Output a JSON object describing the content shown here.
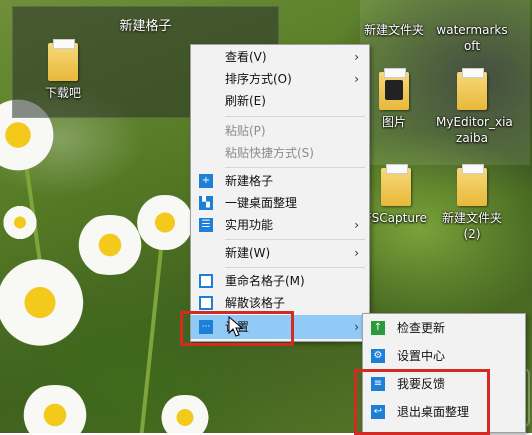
{
  "fence": {
    "title": "新建格子",
    "items": [
      {
        "name": "下载吧"
      }
    ]
  },
  "desktop_icons": [
    {
      "label": "新建文件夹"
    },
    {
      "label": "watermarks oft"
    },
    {
      "label": "图片"
    },
    {
      "label": "MyEditor_xia zaiba"
    },
    {
      "label": "FSCapture"
    },
    {
      "label": "新建文件夹 (2)"
    }
  ],
  "context_menu": {
    "items": [
      {
        "label": "查看(V)",
        "submenu": true
      },
      {
        "label": "排序方式(O)",
        "submenu": true
      },
      {
        "label": "刷新(E)"
      },
      {
        "label": "粘贴(P)",
        "disabled": true
      },
      {
        "label": "粘贴快捷方式(S)",
        "disabled": true
      },
      {
        "label": "新建格子",
        "icon": "plus-icon"
      },
      {
        "label": "一键桌面整理",
        "icon": "layout-icon"
      },
      {
        "label": "实用功能",
        "icon": "list-icon",
        "submenu": true
      },
      {
        "label": "新建(W)",
        "submenu": true
      },
      {
        "label": "重命名格子(M)",
        "icon": "edit-icon"
      },
      {
        "label": "解散该格子",
        "icon": "dissolve-icon"
      },
      {
        "label": "设置",
        "icon": "more-icon",
        "submenu": true,
        "highlighted": true
      }
    ]
  },
  "sub_menu": {
    "items": [
      {
        "label": "检查更新",
        "icon": "upload-arrow-icon"
      },
      {
        "label": "设置中心",
        "icon": "gear-icon"
      },
      {
        "label": "我要反馈",
        "icon": "feedback-icon"
      },
      {
        "label": "退出桌面整理",
        "icon": "exit-icon"
      }
    ]
  },
  "colors": {
    "highlight": "#91c9f7",
    "accent_blue": "#1e7fd6",
    "accent_green": "#2b9b3e",
    "annotation_red": "#d42a24"
  }
}
